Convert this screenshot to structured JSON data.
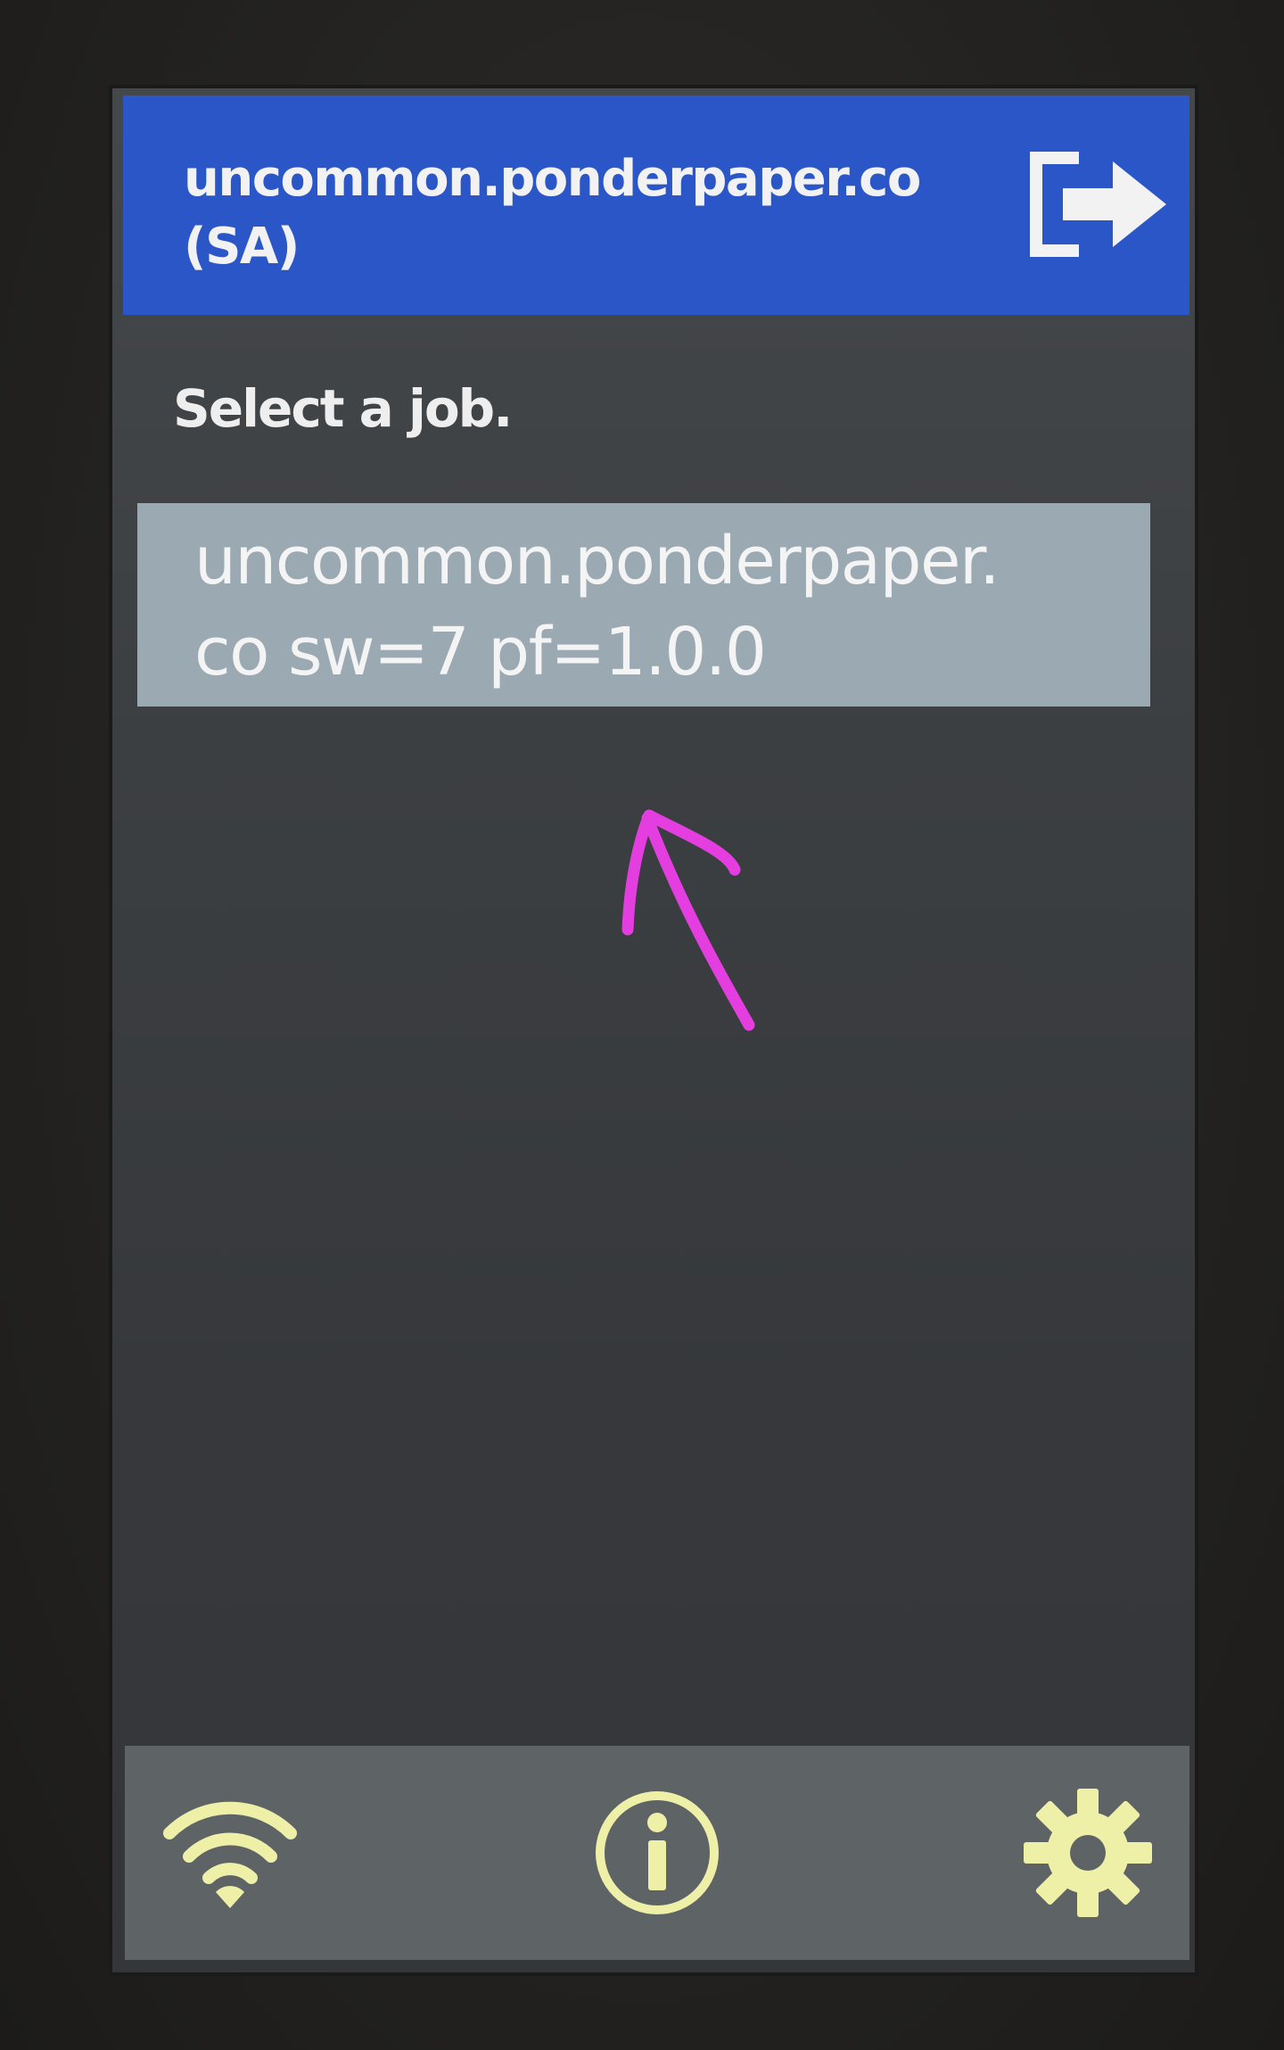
{
  "header": {
    "title_line1": "uncommon.ponderpaper.co",
    "title_line2": "(SA)",
    "exit_icon": "logout-icon",
    "color": "#2b56c8"
  },
  "prompt": "Select a job.",
  "jobs": [
    {
      "label_line1": "uncommon.ponderpaper.",
      "label_line2": "co sw=7 pf=1.0.0",
      "color": "#9aa9b2"
    }
  ],
  "annotation": {
    "icon": "arrow-annotation-icon",
    "color": "#e53ee0"
  },
  "footer": {
    "icons": [
      "wifi-icon",
      "info-icon",
      "gear-icon"
    ],
    "icon_color": "#eef0a8"
  }
}
